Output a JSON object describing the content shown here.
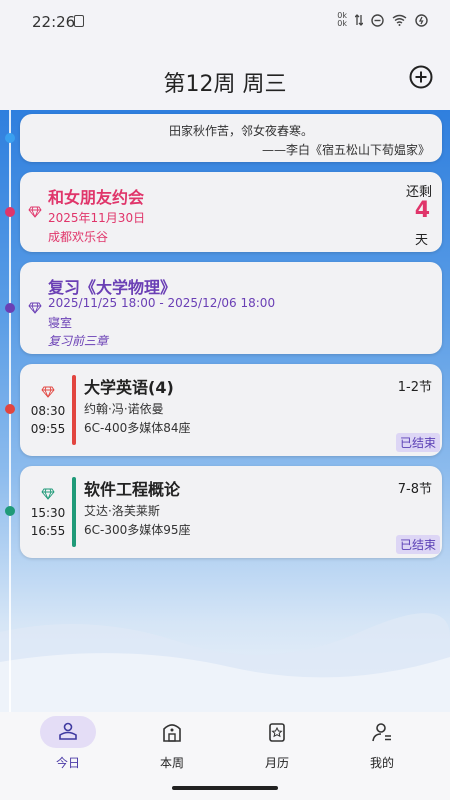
{
  "status_bar": {
    "time": "22:26",
    "network_speed_top": "0k",
    "network_speed_bottom": "0k"
  },
  "header": {
    "title": "第12周 周三",
    "add_icon": "plus-circle-icon"
  },
  "quote": {
    "text": "田家秋作苦，邻女夜舂寒。",
    "source": "——李白《宿五松山下荀媪家》"
  },
  "event": {
    "title": "和女朋友约会",
    "date": "2025年11月30日",
    "location": "成都欢乐谷",
    "countdown_label": "还剩",
    "countdown_value": "4",
    "countdown_unit": "天",
    "color": "#e0356a"
  },
  "review": {
    "title": "复习《大学物理》",
    "date_range": "2025/11/25 18:00 - 2025/12/06 18:00",
    "location": "寝室",
    "note": "复习前三章",
    "color": "#6a3fb5"
  },
  "courses": [
    {
      "start": "08:30",
      "end": "09:55",
      "name": "大学英语(4)",
      "teacher": "约翰·冯·诺依曼",
      "room": "6C-400多媒体84座",
      "sections": "1-2节",
      "status": "已结束",
      "color": "#e2453f"
    },
    {
      "start": "15:30",
      "end": "16:55",
      "name": "软件工程概论",
      "teacher": "艾达·洛芙莱斯",
      "room": "6C-300多媒体95座",
      "sections": "7-8节",
      "status": "已结束",
      "color": "#1f9a78"
    }
  ],
  "nav": {
    "today": "今日",
    "week": "本周",
    "calendar": "月历",
    "mine": "我的"
  }
}
